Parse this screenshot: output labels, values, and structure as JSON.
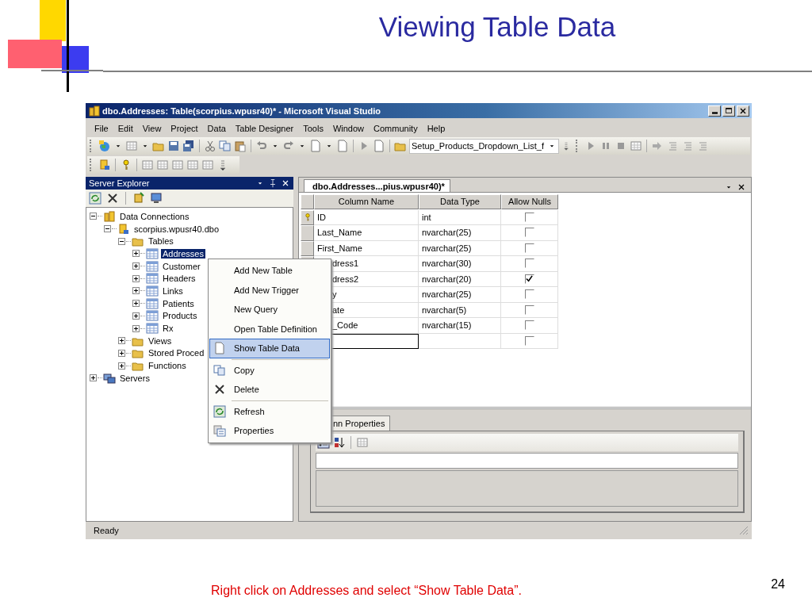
{
  "slide": {
    "title": "Viewing Table Data",
    "caption": "Right click on Addresses and select “Show Table Data”.",
    "page_number": "24"
  },
  "window": {
    "title": "dbo.Addresses: Table(scorpius.wpusr40)* - Microsoft Visual Studio"
  },
  "menu_bar": [
    "File",
    "Edit",
    "View",
    "Project",
    "Data",
    "Table Designer",
    "Tools",
    "Window",
    "Community",
    "Help"
  ],
  "toolbar": {
    "configuration": "Setup_Products_Dropdown_List_f"
  },
  "server_explorer": {
    "title": "Server Explorer",
    "tree": [
      {
        "label": "Data Connections",
        "kind": "connections",
        "expanded": true,
        "selected": false,
        "children": [
          {
            "label": "scorpius.wpusr40.dbo",
            "kind": "database",
            "expanded": true,
            "selected": false,
            "children": [
              {
                "label": "Tables",
                "kind": "folder",
                "expanded": true,
                "selected": false,
                "children": [
                  {
                    "label": "Addresses",
                    "kind": "table",
                    "expanded": false,
                    "selected": true
                  },
                  {
                    "label": "Customer",
                    "kind": "table",
                    "expanded": false,
                    "selected": false
                  },
                  {
                    "label": "Headers",
                    "kind": "table",
                    "expanded": false,
                    "selected": false
                  },
                  {
                    "label": "Links",
                    "kind": "table",
                    "expanded": false,
                    "selected": false
                  },
                  {
                    "label": "Patients",
                    "kind": "table",
                    "expanded": false,
                    "selected": false
                  },
                  {
                    "label": "Products",
                    "kind": "table",
                    "expanded": false,
                    "selected": false
                  },
                  {
                    "label": "Rx",
                    "kind": "table",
                    "expanded": false,
                    "selected": false
                  }
                ]
              },
              {
                "label": "Views",
                "kind": "folder",
                "expanded": false,
                "selected": false
              },
              {
                "label": "Stored Proced",
                "kind": "folder",
                "expanded": false,
                "selected": false
              },
              {
                "label": "Functions",
                "kind": "folder",
                "expanded": false,
                "selected": false
              }
            ]
          }
        ]
      },
      {
        "label": "Servers",
        "kind": "servers",
        "expanded": false,
        "selected": false
      }
    ]
  },
  "document_tab": {
    "title": "dbo.Addresses...pius.wpusr40)*"
  },
  "table_designer": {
    "columns": [
      "Column Name",
      "Data Type",
      "Allow Nulls"
    ],
    "rows": [
      {
        "name": "ID",
        "type": "int",
        "allow_nulls": false,
        "primary_key": true
      },
      {
        "name": "Last_Name",
        "type": "nvarchar(25)",
        "allow_nulls": false
      },
      {
        "name": "First_Name",
        "type": "nvarchar(25)",
        "allow_nulls": false
      },
      {
        "name": "dress1",
        "type": "nvarchar(30)",
        "allow_nulls": false
      },
      {
        "name": "dress2",
        "type": "nvarchar(20)",
        "allow_nulls": true
      },
      {
        "name": "y",
        "type": "nvarchar(25)",
        "allow_nulls": false
      },
      {
        "name": "ate",
        "type": "nvarchar(5)",
        "allow_nulls": false
      },
      {
        "name": "_Code",
        "type": "nvarchar(15)",
        "allow_nulls": false
      },
      {
        "allow_nulls": false
      }
    ]
  },
  "properties": {
    "tab": "nn Properties"
  },
  "context_menu": {
    "groups": [
      [
        {
          "label": "Add New Table",
          "selected": false
        },
        {
          "label": "Add New Trigger",
          "selected": false
        },
        {
          "label": "New Query",
          "selected": false
        },
        {
          "label": "Open Table Definition",
          "selected": false
        },
        {
          "label": "Show Table Data",
          "selected": true
        }
      ],
      [
        {
          "label": "Copy",
          "selected": false
        },
        {
          "label": "Delete",
          "selected": false
        }
      ],
      [
        {
          "label": "Refresh",
          "selected": false
        },
        {
          "label": "Properties",
          "selected": false
        }
      ]
    ]
  },
  "status_bar": {
    "text": "Ready"
  }
}
